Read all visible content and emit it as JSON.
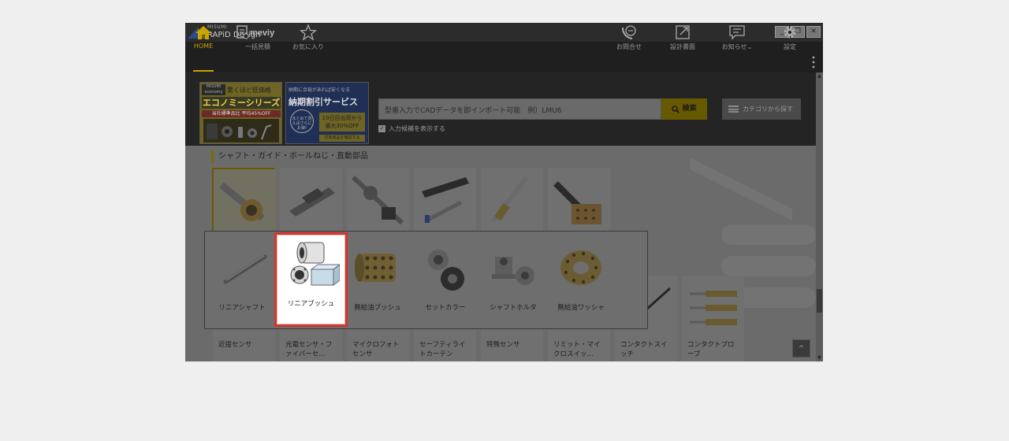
{
  "app": {
    "brand_small": "MISUMI",
    "brand_name": "RAPiD Design",
    "window_buttons": [
      "_",
      "❐",
      "✕"
    ]
  },
  "nav": {
    "left": [
      {
        "label": "HOME",
        "icon": "home-icon",
        "active": true
      },
      {
        "label": "一括見積",
        "icon": "meviy-icon",
        "brand": "meviy"
      },
      {
        "label": "お気に入り",
        "icon": "star-icon"
      }
    ],
    "right": [
      {
        "label": "お問合せ",
        "icon": "support-icon"
      },
      {
        "label": "設計書面",
        "icon": "external-link-icon"
      },
      {
        "label": "お知らせ⌄",
        "icon": "chat-icon"
      },
      {
        "label": "設定",
        "icon": "gear-icon"
      }
    ]
  },
  "banners": {
    "economy": {
      "badge_top": "MISUMI",
      "badge_bottom": "economy",
      "catch": "驚くほど低価格",
      "title": "エコノミーシリーズ",
      "sub": "当社標準品比 平均45%OFF"
    },
    "discount": {
      "catch": "納期に余裕があれば安くなる",
      "title": "納期割引サービス",
      "circle": "まとめて見えばさらにお得!",
      "days_line1": "10日目出荷から",
      "days_line2": "最大30%OFF",
      "tag": "対象商品を確認する"
    }
  },
  "search": {
    "placeholder": "型番入力でCADデータを即インポート可能　例）LMU6",
    "button": "検索",
    "category_button": "カテゴリから探す",
    "suggest_label": "入力候補を表示する",
    "suggest_checked": true
  },
  "section": {
    "title": "シャフト・ガイド・ボールねじ・直動部品"
  },
  "top_cards": [
    {
      "label": "",
      "selected": true
    },
    {
      "label": ""
    },
    {
      "label": ""
    },
    {
      "label": ""
    },
    {
      "label": ""
    },
    {
      "label": ""
    }
  ],
  "popup": {
    "items": [
      {
        "label": "リニアシャフト"
      },
      {
        "label": "リニアブッシュ",
        "highlighted": true
      },
      {
        "label": "無給油ブッシュ"
      },
      {
        "label": "セットカラー"
      },
      {
        "label": "シャフトホルダ"
      },
      {
        "label": "無給油ワッシャ"
      }
    ]
  },
  "bottom_cards": [
    {
      "line1": "近接センサ",
      "line2": ""
    },
    {
      "line1": "光電センサ・フ",
      "line2": "ァイバーセ…"
    },
    {
      "line1": "マイクロフォト",
      "line2": "センサ"
    },
    {
      "line1": "セーフティライ",
      "line2": "トカーテン"
    },
    {
      "line1": "特殊センサ",
      "line2": ""
    },
    {
      "line1": "リミット・マイ",
      "line2": "クロスイッ…"
    },
    {
      "line1": "コンタクトスイ",
      "line2": "ッチ"
    },
    {
      "line1": "コンタクトプロ",
      "line2": "ーブ"
    }
  ],
  "colors": {
    "accent": "#caa400",
    "highlight_border": "#d0362d",
    "overlay_bg": "#6b6b6b",
    "titlebar": "#2c2c2c"
  }
}
